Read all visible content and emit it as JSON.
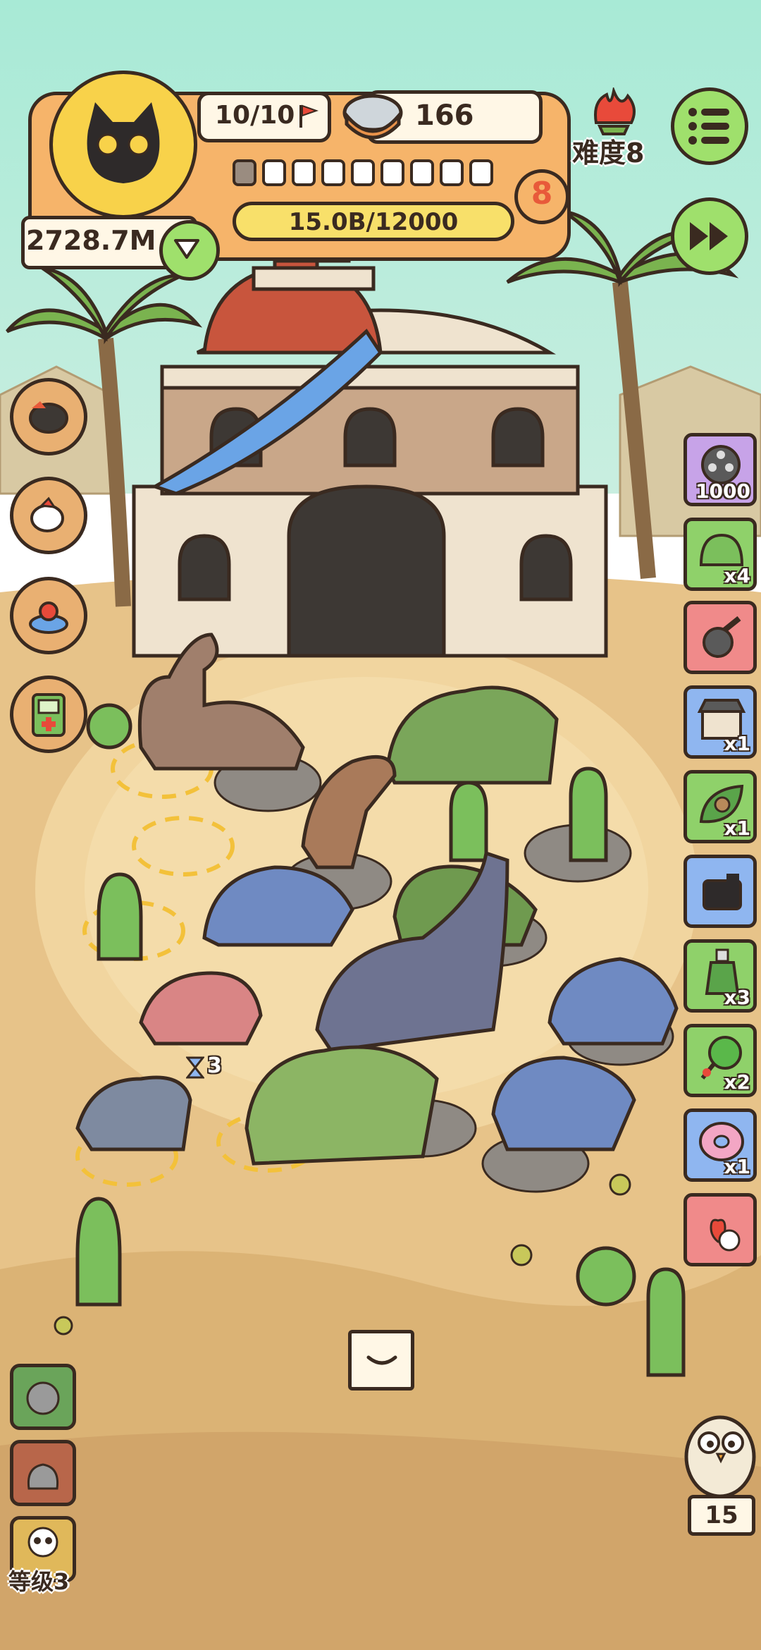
{
  "hud": {
    "flag_count": "10/10",
    "bowl_count": "166",
    "difficulty_label": "难度8",
    "level_number": "8",
    "progress_text": "15.0B/12000",
    "money": "2728.7M",
    "progress_segments": {
      "total": 9,
      "filled": 1
    }
  },
  "side_items": [
    {
      "name": "film-reel-item",
      "count": "1000",
      "bg": "#c7a3e8"
    },
    {
      "name": "green-helmet-item",
      "count": "x4",
      "bg": "#8fd16a"
    },
    {
      "name": "meteor-item",
      "count": "",
      "bg": "#f08a8a"
    },
    {
      "name": "shop-item",
      "count": "x1",
      "bg": "#8fb6f0"
    },
    {
      "name": "leaf-nest-item",
      "count": "x1",
      "bg": "#8fd16a"
    },
    {
      "name": "camera-item",
      "count": "",
      "bg": "#8fb6f0"
    },
    {
      "name": "potion-item",
      "count": "x3",
      "bg": "#8fd16a"
    },
    {
      "name": "lollipop-item",
      "count": "x2",
      "bg": "#8fd16a"
    },
    {
      "name": "donut-item",
      "count": "x1",
      "bg": "#8fb6f0"
    },
    {
      "name": "hearts-item",
      "count": "",
      "bg": "#f08a8a"
    }
  ],
  "bottom_left": {
    "grade_label": "等级3"
  },
  "bottom_right": {
    "bird_count": "15"
  },
  "timer_badge": {
    "value": "3"
  },
  "colors": {
    "sky": "#a8ead6",
    "sand": "#e7c389",
    "sand_dark": "#d1a56a",
    "hud_orange": "#f6b46a",
    "hud_yellow": "#f8e06a",
    "green_btn": "#9fe06c"
  }
}
